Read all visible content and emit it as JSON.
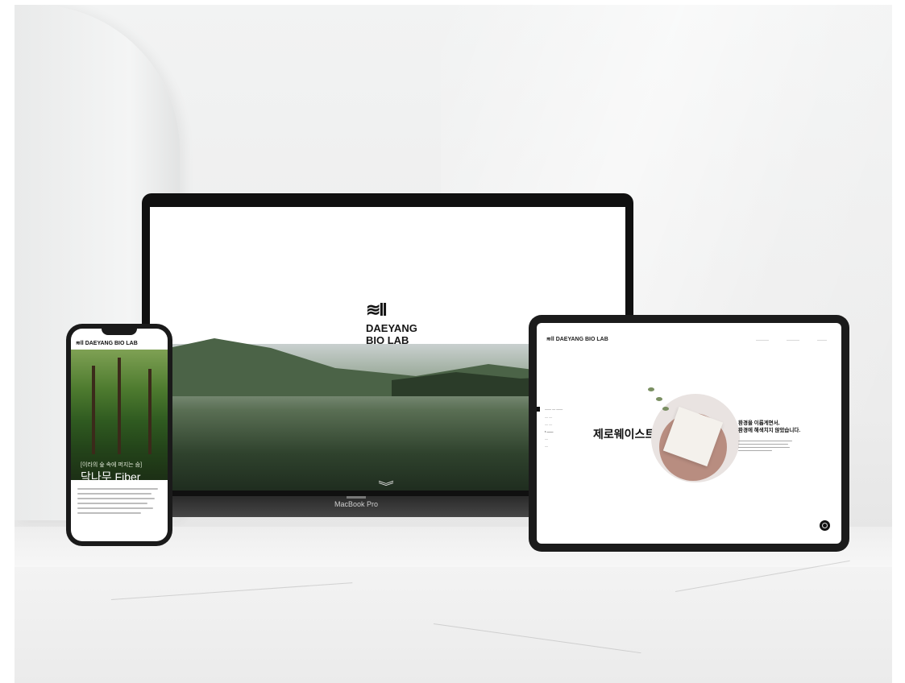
{
  "laptop": {
    "logo_mark": "≋ll",
    "logo_line1": "DAEYANG",
    "logo_line2": "BIO LAB",
    "scroll_icon": "chevron-down-double-icon",
    "brand": "MacBook Pro"
  },
  "phone": {
    "caption_small": "[이라의 숲 속에 퍼지는 숨]",
    "title": "닥나무 Fiber",
    "header_logo": "≋ll DAEYANG BIO LAB"
  },
  "tablet": {
    "header_logo": "≋ll DAEYANG BIO LAB",
    "title": "제로웨이스트",
    "headline_line1": "환경을 이롭게면서,",
    "headline_line2": "환경에 해색치지 않았습니다."
  }
}
